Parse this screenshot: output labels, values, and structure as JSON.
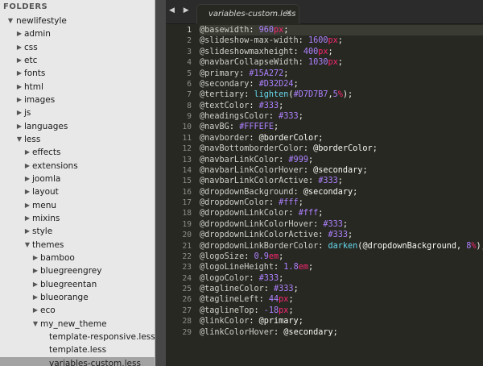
{
  "sidebar": {
    "header": "FOLDERS",
    "items": [
      {
        "label": "newlifestyle",
        "arrow": "▼",
        "level": 0,
        "selected": false
      },
      {
        "label": "admin",
        "arrow": "▶",
        "level": 1,
        "selected": false
      },
      {
        "label": "css",
        "arrow": "▶",
        "level": 1,
        "selected": false
      },
      {
        "label": "etc",
        "arrow": "▶",
        "level": 1,
        "selected": false
      },
      {
        "label": "fonts",
        "arrow": "▶",
        "level": 1,
        "selected": false
      },
      {
        "label": "html",
        "arrow": "▶",
        "level": 1,
        "selected": false
      },
      {
        "label": "images",
        "arrow": "▶",
        "level": 1,
        "selected": false
      },
      {
        "label": "js",
        "arrow": "▶",
        "level": 1,
        "selected": false
      },
      {
        "label": "languages",
        "arrow": "▶",
        "level": 1,
        "selected": false
      },
      {
        "label": "less",
        "arrow": "▼",
        "level": 1,
        "selected": false
      },
      {
        "label": "effects",
        "arrow": "▶",
        "level": 2,
        "selected": false
      },
      {
        "label": "extensions",
        "arrow": "▶",
        "level": 2,
        "selected": false
      },
      {
        "label": "joomla",
        "arrow": "▶",
        "level": 2,
        "selected": false
      },
      {
        "label": "layout",
        "arrow": "▶",
        "level": 2,
        "selected": false
      },
      {
        "label": "menu",
        "arrow": "▶",
        "level": 2,
        "selected": false
      },
      {
        "label": "mixins",
        "arrow": "▶",
        "level": 2,
        "selected": false
      },
      {
        "label": "style",
        "arrow": "▶",
        "level": 2,
        "selected": false
      },
      {
        "label": "themes",
        "arrow": "▼",
        "level": 2,
        "selected": false
      },
      {
        "label": "bamboo",
        "arrow": "▶",
        "level": 3,
        "selected": false
      },
      {
        "label": "bluegreengrey",
        "arrow": "▶",
        "level": 3,
        "selected": false
      },
      {
        "label": "bluegreentan",
        "arrow": "▶",
        "level": 3,
        "selected": false
      },
      {
        "label": "blueorange",
        "arrow": "▶",
        "level": 3,
        "selected": false
      },
      {
        "label": "eco",
        "arrow": "▶",
        "level": 3,
        "selected": false
      },
      {
        "label": "my_new_theme",
        "arrow": "▼",
        "level": 3,
        "selected": false
      },
      {
        "label": "template-responsive.less",
        "arrow": "",
        "level": 4,
        "selected": false
      },
      {
        "label": "template.less",
        "arrow": "",
        "level": 4,
        "selected": false
      },
      {
        "label": "variables-custom.less",
        "arrow": "",
        "level": 4,
        "selected": true
      }
    ]
  },
  "editor": {
    "nav_arrows": "◀ ▶",
    "tab_title": "variables-custom.less",
    "tab_close": "✕",
    "current_line": 1,
    "lines": [
      [
        [
          "@basewidth",
          "t-at"
        ],
        [
          ": ",
          "t-punc"
        ],
        [
          "960",
          "t-num"
        ],
        [
          "px",
          "t-unit"
        ],
        [
          ";",
          "t-punc"
        ]
      ],
      [
        [
          "@slideshow-max-width",
          "t-at"
        ],
        [
          ": ",
          "t-punc"
        ],
        [
          "1600",
          "t-num"
        ],
        [
          "px",
          "t-unit"
        ],
        [
          ";",
          "t-punc"
        ]
      ],
      [
        [
          "@slideshowmaxheight",
          "t-at"
        ],
        [
          ": ",
          "t-punc"
        ],
        [
          "400",
          "t-num"
        ],
        [
          "px",
          "t-unit"
        ],
        [
          ";",
          "t-punc"
        ]
      ],
      [
        [
          "@navbarCollapseWidth",
          "t-at"
        ],
        [
          ": ",
          "t-punc"
        ],
        [
          "1030",
          "t-num"
        ],
        [
          "px",
          "t-unit"
        ],
        [
          ";",
          "t-punc"
        ]
      ],
      [
        [
          "@primary",
          "t-at"
        ],
        [
          ": ",
          "t-punc"
        ],
        [
          "#15A272",
          "t-num"
        ],
        [
          ";",
          "t-punc"
        ]
      ],
      [
        [
          "@secondary",
          "t-at"
        ],
        [
          ": ",
          "t-punc"
        ],
        [
          "#D32D24",
          "t-num"
        ],
        [
          ";",
          "t-punc"
        ]
      ],
      [
        [
          "@tertiary",
          "t-at"
        ],
        [
          ": ",
          "t-punc"
        ],
        [
          "lighten",
          "t-fn"
        ],
        [
          "(",
          "t-punc"
        ],
        [
          "#D7D7B7",
          "t-num"
        ],
        [
          ",",
          "t-punc"
        ],
        [
          "5",
          "t-num"
        ],
        [
          "%",
          "t-unit"
        ],
        [
          ");",
          "t-punc"
        ]
      ],
      [
        [
          "@textColor",
          "t-at"
        ],
        [
          ": ",
          "t-punc"
        ],
        [
          "#333",
          "t-num"
        ],
        [
          ";",
          "t-punc"
        ]
      ],
      [
        [
          "@headingsColor",
          "t-at"
        ],
        [
          ": ",
          "t-punc"
        ],
        [
          "#333",
          "t-num"
        ],
        [
          ";",
          "t-punc"
        ]
      ],
      [
        [
          "@navBG",
          "t-at"
        ],
        [
          ": ",
          "t-punc"
        ],
        [
          "#FFFEFE",
          "t-num"
        ],
        [
          ";",
          "t-punc"
        ]
      ],
      [
        [
          "@navborder",
          "t-at"
        ],
        [
          ": ",
          "t-punc"
        ],
        [
          "@borderColor",
          "t-prop"
        ],
        [
          ";",
          "t-punc"
        ]
      ],
      [
        [
          "@navBottomborderColor",
          "t-at"
        ],
        [
          ": ",
          "t-punc"
        ],
        [
          "@borderColor",
          "t-prop"
        ],
        [
          ";",
          "t-punc"
        ]
      ],
      [
        [
          "@navbarLinkColor",
          "t-at"
        ],
        [
          ": ",
          "t-punc"
        ],
        [
          "#999",
          "t-num"
        ],
        [
          ";",
          "t-punc"
        ]
      ],
      [
        [
          "@navbarLinkColorHover",
          "t-at"
        ],
        [
          ": ",
          "t-punc"
        ],
        [
          "@secondary",
          "t-prop"
        ],
        [
          ";",
          "t-punc"
        ]
      ],
      [
        [
          "@navbarLinkColorActive",
          "t-at"
        ],
        [
          ": ",
          "t-punc"
        ],
        [
          "#333",
          "t-num"
        ],
        [
          ";",
          "t-punc"
        ]
      ],
      [
        [
          "@dropdownBackground",
          "t-at"
        ],
        [
          ": ",
          "t-punc"
        ],
        [
          "@secondary",
          "t-prop"
        ],
        [
          ";",
          "t-punc"
        ]
      ],
      [
        [
          "@dropdownColor",
          "t-at"
        ],
        [
          ": ",
          "t-punc"
        ],
        [
          "#fff",
          "t-num"
        ],
        [
          ";",
          "t-punc"
        ]
      ],
      [
        [
          "@dropdownLinkColor",
          "t-at"
        ],
        [
          ": ",
          "t-punc"
        ],
        [
          "#fff",
          "t-num"
        ],
        [
          ";",
          "t-punc"
        ]
      ],
      [
        [
          "@dropdownLinkColorHover",
          "t-at"
        ],
        [
          ": ",
          "t-punc"
        ],
        [
          "#333",
          "t-num"
        ],
        [
          ";",
          "t-punc"
        ]
      ],
      [
        [
          "@dropdownLinkColorActive",
          "t-at"
        ],
        [
          ": ",
          "t-punc"
        ],
        [
          "#333",
          "t-num"
        ],
        [
          ";",
          "t-punc"
        ]
      ],
      [
        [
          "@dropdownLinkBorderColor",
          "t-at"
        ],
        [
          ": ",
          "t-punc"
        ],
        [
          "darken",
          "t-fn"
        ],
        [
          "(",
          "t-punc"
        ],
        [
          "@dropdownBackground",
          "t-prop"
        ],
        [
          ", ",
          "t-punc"
        ],
        [
          "8",
          "t-num"
        ],
        [
          "%",
          "t-unit"
        ],
        [
          ");",
          "t-punc"
        ]
      ],
      [
        [
          "@logoSize",
          "t-at"
        ],
        [
          ": ",
          "t-punc"
        ],
        [
          "0.9",
          "t-num"
        ],
        [
          "em",
          "t-unit"
        ],
        [
          ";",
          "t-punc"
        ]
      ],
      [
        [
          "@logoLineHeight",
          "t-at"
        ],
        [
          ": ",
          "t-punc"
        ],
        [
          "1.8",
          "t-num"
        ],
        [
          "em",
          "t-unit"
        ],
        [
          ";",
          "t-punc"
        ]
      ],
      [
        [
          "@logoColor",
          "t-at"
        ],
        [
          ": ",
          "t-punc"
        ],
        [
          "#333",
          "t-num"
        ],
        [
          ";",
          "t-punc"
        ]
      ],
      [
        [
          "@taglineColor",
          "t-at"
        ],
        [
          ": ",
          "t-punc"
        ],
        [
          "#333",
          "t-num"
        ],
        [
          ";",
          "t-punc"
        ]
      ],
      [
        [
          "@taglineLeft",
          "t-at"
        ],
        [
          ": ",
          "t-punc"
        ],
        [
          "44",
          "t-num"
        ],
        [
          "px",
          "t-unit"
        ],
        [
          ";",
          "t-punc"
        ]
      ],
      [
        [
          "@taglineTop",
          "t-at"
        ],
        [
          ": ",
          "t-punc"
        ],
        [
          "-18",
          "t-num"
        ],
        [
          "px",
          "t-unit"
        ],
        [
          ";",
          "t-punc"
        ]
      ],
      [
        [
          "@linkColor",
          "t-at"
        ],
        [
          ": ",
          "t-punc"
        ],
        [
          "@primary",
          "t-prop"
        ],
        [
          ";",
          "t-punc"
        ]
      ],
      [
        [
          "@linkColorHover",
          "t-at"
        ],
        [
          ": ",
          "t-punc"
        ],
        [
          "@secondary",
          "t-prop"
        ],
        [
          ";",
          "t-punc"
        ]
      ]
    ]
  }
}
